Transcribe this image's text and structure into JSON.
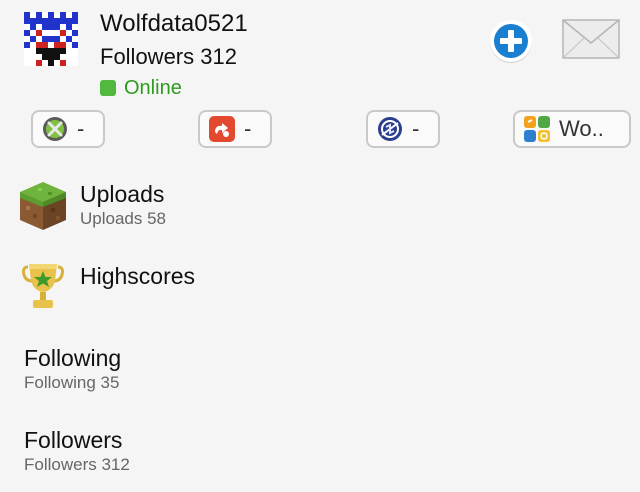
{
  "profile": {
    "username": "Wolfdata0521",
    "followers_text": "Followers 312",
    "status": "Online",
    "status_color": "#53b83f",
    "avatar_icon": "pixel-avatar-icon"
  },
  "actions": {
    "add_icon": "plus-circle-icon",
    "mail_icon": "envelope-icon"
  },
  "platforms": [
    {
      "icon": "xbox-icon",
      "label": "-"
    },
    {
      "icon": "app-icon",
      "label": "-"
    },
    {
      "icon": "playstation-network-icon",
      "label": "-"
    },
    {
      "icon": "game-center-icon",
      "label": "Wo.."
    }
  ],
  "menu": {
    "uploads": {
      "title": "Uploads",
      "subtitle": "Uploads 58",
      "icon": "grass-block-icon"
    },
    "highscores": {
      "title": "Highscores",
      "icon": "trophy-icon"
    },
    "following": {
      "title": "Following",
      "subtitle": "Following 35"
    },
    "followers": {
      "title": "Followers",
      "subtitle": "Followers 312"
    }
  }
}
